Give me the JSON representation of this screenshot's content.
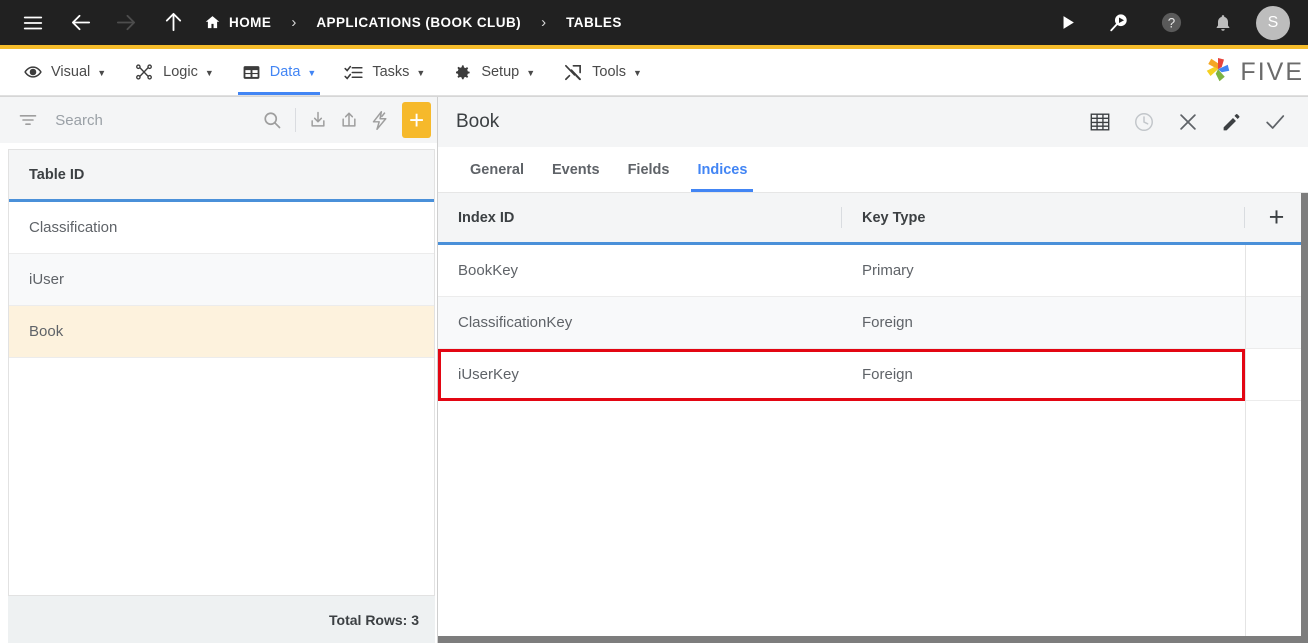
{
  "topbar": {
    "menu_icon": "hamburger-icon",
    "back_icon": "arrow-left-icon",
    "forward_icon": "arrow-right-icon",
    "up_icon": "arrow-up-icon",
    "breadcrumbs": [
      {
        "label": "HOME",
        "icon": "home-icon"
      },
      {
        "label": "APPLICATIONS (BOOK CLUB)",
        "icon": ""
      },
      {
        "label": "TABLES",
        "icon": ""
      }
    ],
    "separator": "›",
    "right_icons": [
      {
        "name": "run-icon"
      },
      {
        "name": "search-run-icon"
      },
      {
        "name": "help-icon"
      },
      {
        "name": "notifications-bell-icon"
      }
    ],
    "avatar_initial": "S",
    "accent_color": "#f5bc2b",
    "background_color": "#212121"
  },
  "menubar": {
    "items": [
      {
        "label": "Visual",
        "icon": "eye-icon",
        "active": false
      },
      {
        "label": "Logic",
        "icon": "logic-flow-icon",
        "active": false
      },
      {
        "label": "Data",
        "icon": "data-grid-icon",
        "active": true
      },
      {
        "label": "Tasks",
        "icon": "tasks-list-icon",
        "active": false
      },
      {
        "label": "Setup",
        "icon": "gear-icon",
        "active": false
      },
      {
        "label": "Tools",
        "icon": "tools-icon",
        "active": false
      }
    ],
    "caret": "▼",
    "active_color": "#4285f4",
    "brand": {
      "word": "FIVE",
      "icon": "five-pinwheel-logo"
    }
  },
  "sidebar": {
    "search": {
      "placeholder": "Search",
      "value": ""
    },
    "toolbar_icons": [
      {
        "name": "filter-icon"
      },
      {
        "name": "search-icon"
      },
      {
        "name": "import-icon"
      },
      {
        "name": "export-icon"
      },
      {
        "name": "lightning-icon"
      }
    ],
    "add_button_label": "+",
    "add_button_color": "#f6b92b",
    "list": {
      "header": "Table ID",
      "rows": [
        {
          "label": "Classification",
          "selected": false
        },
        {
          "label": "iUser",
          "selected": false
        },
        {
          "label": "Book",
          "selected": true
        }
      ]
    },
    "footer": "Total Rows: 3"
  },
  "panel": {
    "title": "Book",
    "header_icons": [
      {
        "name": "table-grid-icon",
        "muted": false
      },
      {
        "name": "history-clock-icon",
        "muted": true
      },
      {
        "name": "close-icon",
        "muted": false
      },
      {
        "name": "edit-pencil-icon",
        "muted": false
      },
      {
        "name": "confirm-check-icon",
        "muted": false
      }
    ],
    "tabs": [
      {
        "label": "General",
        "active": false
      },
      {
        "label": "Events",
        "active": false
      },
      {
        "label": "Fields",
        "active": false
      },
      {
        "label": "Indices",
        "active": true
      }
    ],
    "grid": {
      "columns": [
        "Index ID",
        "Key Type"
      ],
      "add_column_label": "+",
      "rows": [
        {
          "index_id": "BookKey",
          "key_type": "Primary",
          "highlighted": false
        },
        {
          "index_id": "ClassificationKey",
          "key_type": "Foreign",
          "highlighted": false
        },
        {
          "index_id": "iUserKey",
          "key_type": "Foreign",
          "highlighted": true
        }
      ]
    },
    "highlight_color": "#e30613"
  }
}
